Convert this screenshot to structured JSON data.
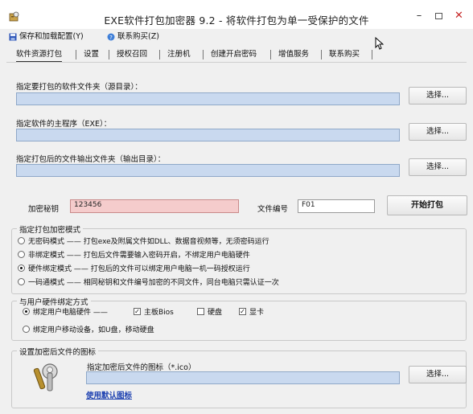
{
  "window": {
    "title": "EXE软件打包加密器 9.2 - 将软件打包为单一受保护的文件",
    "min_label": "–",
    "close_label": "✕"
  },
  "menu": {
    "save_label": "保存和加载配置(Y)",
    "contact_label": "联系购买(Z)"
  },
  "tabs": [
    "软件资源打包",
    "设置",
    "授权召回",
    "注册机",
    "创建开启密码",
    "增值服务",
    "联系购买"
  ],
  "source": {
    "label": "指定要打包的软件文件夹（源目录）：",
    "value": "",
    "button": "选择..."
  },
  "main_exe": {
    "label": "指定软件的主程序（EXE）：",
    "value": "",
    "button": "选择..."
  },
  "output": {
    "label": "指定打包后的文件输出文件夹（输出目录）：",
    "value": "",
    "button": "选择..."
  },
  "key": {
    "label": "加密秘钥",
    "value": "123456"
  },
  "file_no": {
    "label": "文件编号",
    "value": "F01"
  },
  "start_button": "开始打包",
  "encrypt_mode": {
    "title": "指定打包加密模式",
    "options": [
      "无密码模式 —— 打包exe及附属文件如DLL、数据音视频等，无须密码运行",
      "非绑定模式 —— 打包后文件需要输入密码开启，不绑定用户电脑硬件",
      "硬件绑定模式 —— 打包后的文件可以绑定用户电脑一机一码授权运行",
      "一码通模式 —— 相同秘钥和文件编号加密的不同文件，同台电脑只需认证一次"
    ],
    "selected": 2
  },
  "hardware_bind": {
    "title": "与用户硬件绑定方式",
    "option_pc": "绑定用户电脑硬件 ——",
    "check_board": "主板Bios",
    "check_disk": "硬盘",
    "check_gpu": "显卡",
    "option_mobile": "绑定用户移动设备，如U盘，移动硬盘",
    "check_mark": "✓"
  },
  "icon_group": {
    "title": "设置加密后文件的图标",
    "label": "指定加密后文件的图标（*.ico）",
    "value": "",
    "button": "选择...",
    "default_link": "使用默认图标"
  }
}
